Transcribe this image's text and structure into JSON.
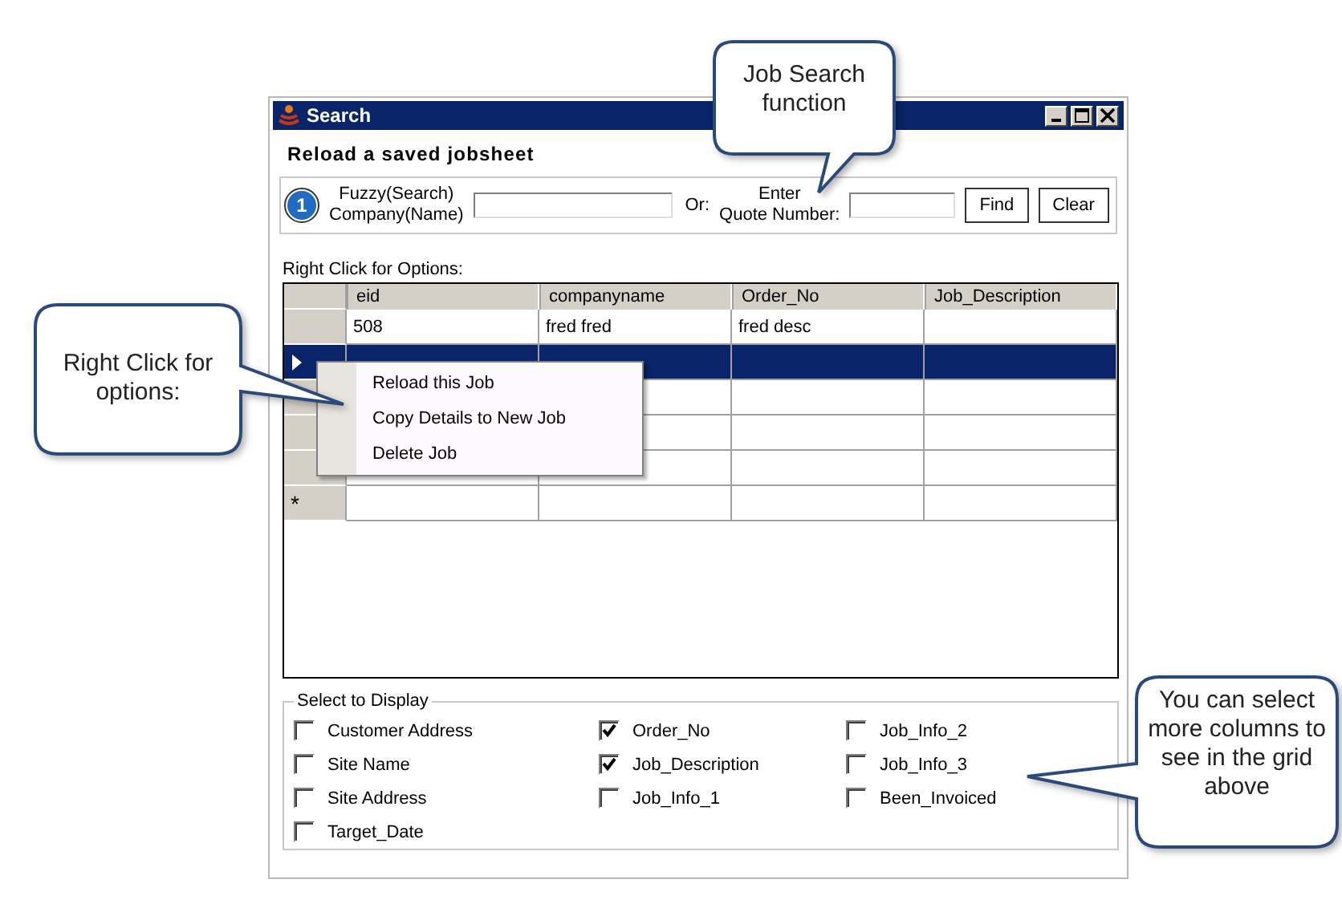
{
  "window": {
    "title": "Search"
  },
  "heading": "Reload a saved jobsheet",
  "search": {
    "badge": "1",
    "company_label": [
      "Fuzzy(Search)",
      "Company(Name)"
    ],
    "or_label": "Or:",
    "quote_label": [
      "Enter",
      "Quote Number:"
    ],
    "buttons": [
      "Find",
      "Clear"
    ]
  },
  "grid_hint": "Right Click for Options:",
  "table": {
    "columns": [
      "eid",
      "companyname",
      "Order_No",
      "Job_Description"
    ],
    "rows": [
      {
        "selected": false,
        "kind": "data",
        "cells": [
          "508",
          "fred fred",
          "fred desc",
          ""
        ]
      },
      {
        "selected": true,
        "kind": "data",
        "cells": [
          "",
          "",
          "",
          ""
        ]
      },
      {
        "selected": false,
        "kind": "data",
        "cells": [
          "",
          "",
          "",
          ""
        ]
      },
      {
        "selected": false,
        "kind": "data",
        "cells": [
          "",
          "",
          "",
          ""
        ]
      },
      {
        "selected": false,
        "kind": "data",
        "cells": [
          "",
          "",
          "",
          ""
        ]
      },
      {
        "selected": false,
        "kind": "new",
        "marker": "*",
        "cells": [
          "",
          "",
          "",
          ""
        ]
      }
    ]
  },
  "context_menu": [
    "Reload this Job",
    "Copy Details to New Job",
    "Delete Job"
  ],
  "display_group": {
    "title": "Select to Display",
    "columns": [
      [
        {
          "label": "Customer Address",
          "checked": false
        },
        {
          "label": "Site Name",
          "checked": false
        },
        {
          "label": "Site Address",
          "checked": false
        },
        {
          "label": "Target_Date",
          "checked": false
        }
      ],
      [
        {
          "label": "Order_No",
          "checked": true
        },
        {
          "label": "Job_Description",
          "checked": true
        },
        {
          "label": "Job_Info_1",
          "checked": false
        }
      ],
      [
        {
          "label": "Job_Info_2",
          "checked": false
        },
        {
          "label": "Job_Info_3",
          "checked": false
        },
        {
          "label": "Been_Invoiced",
          "checked": false
        }
      ]
    ]
  },
  "callouts": [
    {
      "text": "Job Search function"
    },
    {
      "text": "Right Click for options:"
    },
    {
      "text": "You can select more columns to see in the grid above"
    }
  ]
}
